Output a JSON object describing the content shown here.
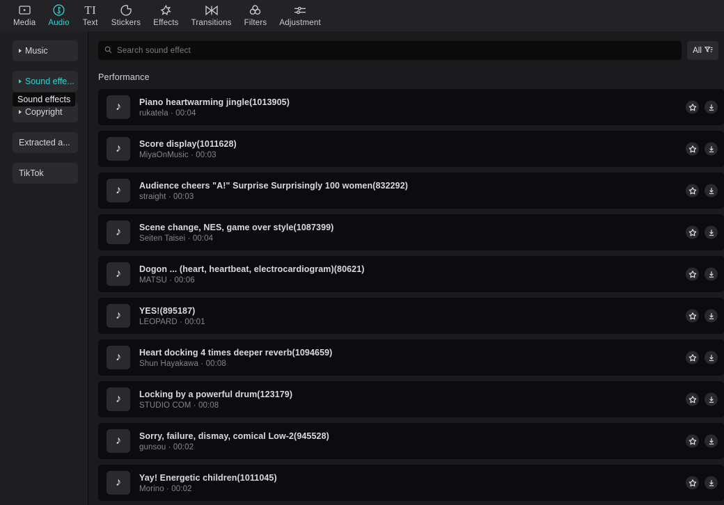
{
  "toolbar": {
    "items": [
      {
        "label": "Media",
        "icon": "media-play-icon",
        "active": false
      },
      {
        "label": "Audio",
        "icon": "audio-note-icon",
        "active": true
      },
      {
        "label": "Text",
        "icon": "text-ti-icon",
        "active": false
      },
      {
        "label": "Stickers",
        "icon": "sticker-circle-icon",
        "active": false
      },
      {
        "label": "Effects",
        "icon": "effects-starburst-icon",
        "active": false
      },
      {
        "label": "Transitions",
        "icon": "transitions-bowtie-icon",
        "active": false
      },
      {
        "label": "Filters",
        "icon": "filters-circles-icon",
        "active": false
      },
      {
        "label": "Adjustment",
        "icon": "adjustment-sliders-icon",
        "active": false
      }
    ]
  },
  "sidebar": {
    "items": [
      {
        "label": "Music",
        "expandable": true,
        "active": false
      },
      {
        "label": "Sound effe...",
        "expandable": true,
        "active": true
      },
      {
        "label": "Copyright",
        "expandable": true,
        "active": false
      },
      {
        "label": "Extracted a...",
        "expandable": false,
        "active": false
      },
      {
        "label": "TikTok",
        "expandable": false,
        "active": false
      }
    ],
    "tooltip": "Sound effects"
  },
  "search": {
    "placeholder": "Search sound effect",
    "value": "",
    "icon": "search-icon"
  },
  "filter": {
    "label": "All",
    "icon": "filter-sort-icon"
  },
  "main": {
    "section_title": "Performance",
    "favorite_icon": "star-icon",
    "download_icon": "download-icon",
    "thumb_icon": "tiktok-note-icon",
    "items": [
      {
        "title": "Piano heartwarming jingle(1013905)",
        "author": "rukatela",
        "duration": "00:04"
      },
      {
        "title": "Score display(1011628)",
        "author": "MiyaOnMusic",
        "duration": "00:03"
      },
      {
        "title": "Audience cheers \"A!\" Surprise Surprisingly 100 women(832292)",
        "author": "straight",
        "duration": "00:03"
      },
      {
        "title": "Scene change, NES, game over style(1087399)",
        "author": "Seiten Taisei",
        "duration": "00:04"
      },
      {
        "title": "Dogon ... (heart, heartbeat, electrocardiogram)(80621)",
        "author": "MATSU",
        "duration": "00:06"
      },
      {
        "title": "YES!(895187)",
        "author": "LEOPARD",
        "duration": "00:01"
      },
      {
        "title": "Heart docking 4 times deeper reverb(1094659)",
        "author": "Shun Hayakawa",
        "duration": "00:08"
      },
      {
        "title": "Locking by a powerful drum(123179)",
        "author": "STUDIO COM",
        "duration": "00:08"
      },
      {
        "title": "Sorry, failure, dismay, comical Low-2(945528)",
        "author": "gunsou",
        "duration": "00:02"
      },
      {
        "title": "Yay! Energetic children(1011045)",
        "author": "Morino",
        "duration": "00:02"
      }
    ],
    "separator": " · "
  },
  "colors": {
    "accent": "#2ed2d2",
    "toolbar_bg": "#232326",
    "sidebar_bg": "#1f1f22",
    "content_bg": "#1b1b1d",
    "row_bg": "#0c0c0e"
  }
}
